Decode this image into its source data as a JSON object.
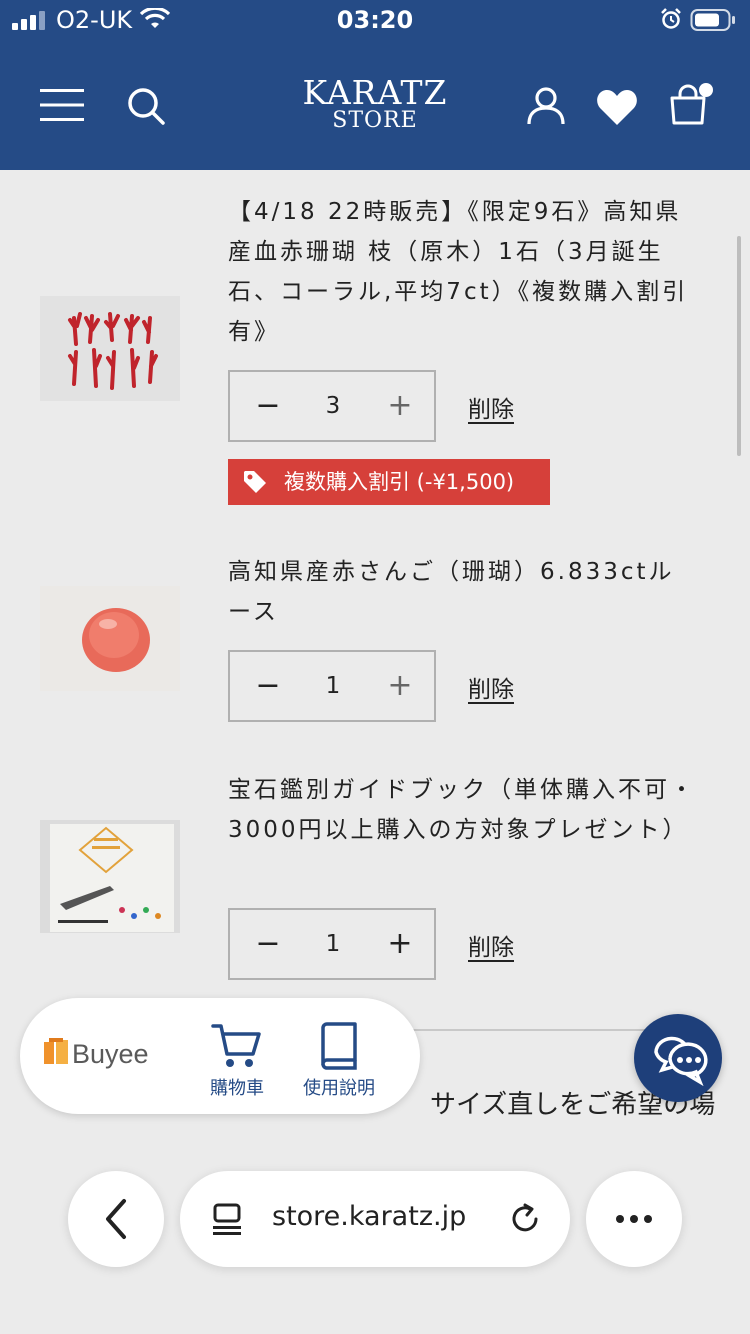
{
  "status_bar": {
    "carrier": "O2-UK",
    "time": "03:20"
  },
  "header": {
    "brand_line1": "KARATZ",
    "brand_line2": "STORE"
  },
  "cart_items": [
    {
      "title": "【4/18 22時販売】《限定9石》高知県産血赤珊瑚 枝（原木）1石（3月誕生石、コーラル,平均7ct）《複数購入割引有》",
      "quantity": "3",
      "delete_label": "削除",
      "discount_label": "複数購入割引 (-¥1,500)"
    },
    {
      "title": "高知県産赤さんご（珊瑚）6.833ctルース",
      "quantity": "1",
      "delete_label": "削除"
    },
    {
      "title": "宝石鑑別ガイドブック（単体購入不可・3000円以上購入の方対象プレゼント）",
      "quantity": "1",
      "delete_label": "削除"
    }
  ],
  "qty_controls": {
    "minus": "−",
    "plus": "+"
  },
  "partial_text": "サイズ直しをご希望の場",
  "buyee": {
    "logo_text": "Buyee",
    "cart_label": "購物車",
    "guide_label": "使用說明"
  },
  "browser": {
    "url": "store.karatz.jp"
  },
  "colors": {
    "header_bg": "#254b86",
    "discount_red": "#d6403a",
    "buyee_orange": "#f0922b"
  }
}
